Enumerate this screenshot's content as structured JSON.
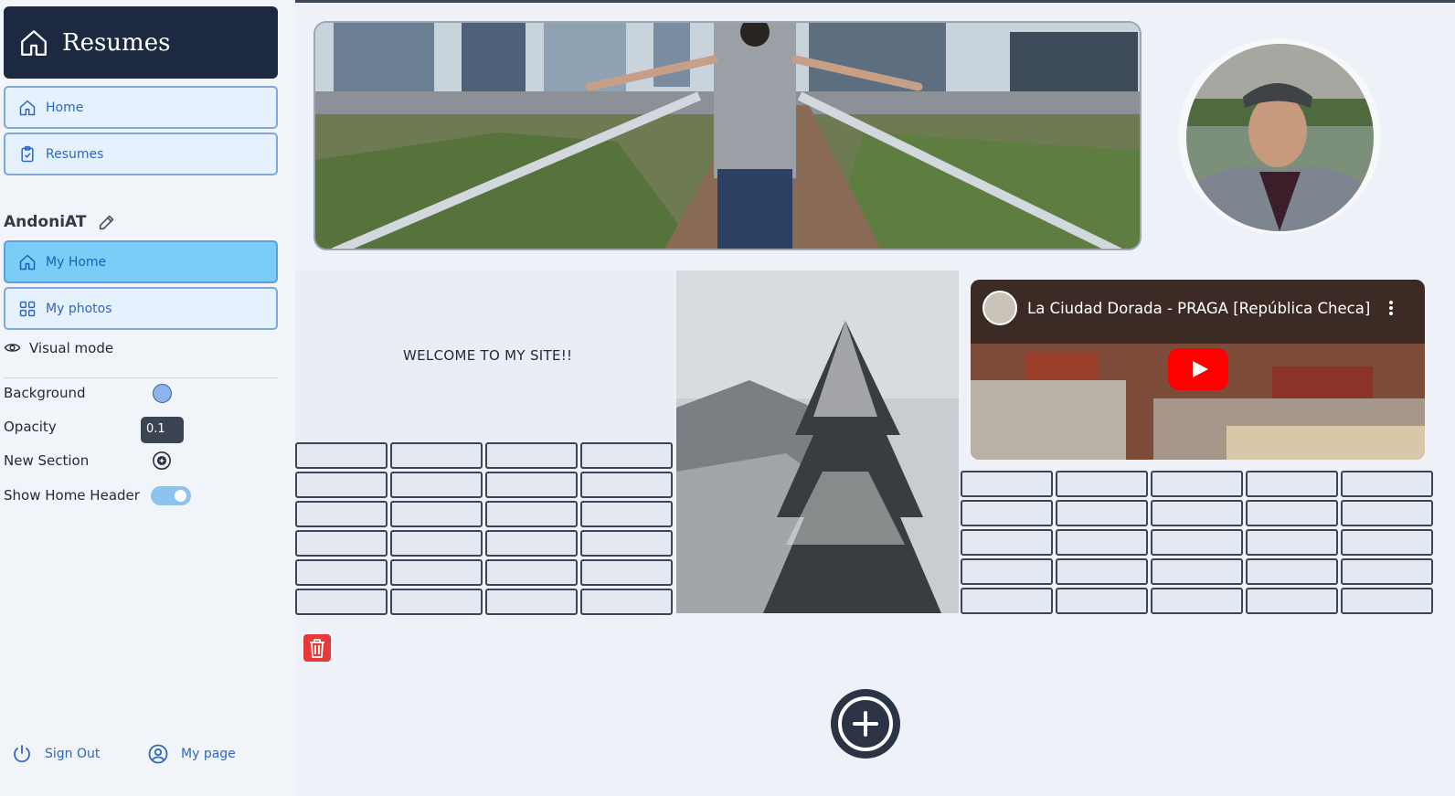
{
  "sidebar": {
    "brand": "Resumes",
    "nav": [
      {
        "label": "Home",
        "icon": "home-icon"
      },
      {
        "label": "Resumes",
        "icon": "clipboard-check-icon"
      }
    ],
    "username": "AndoniAT",
    "user_nav": [
      {
        "label": "My Home",
        "icon": "home-icon",
        "active": true
      },
      {
        "label": "My photos",
        "icon": "grid-icon",
        "active": false
      }
    ],
    "visual_mode_label": "Visual mode",
    "settings": {
      "background_label": "Background",
      "background_color": "#8db3ec",
      "opacity_label": "Opacity",
      "opacity_value": "0.1",
      "new_section_label": "New Section",
      "show_header_label": "Show Home Header",
      "show_header_on": true
    },
    "footer": {
      "sign_out": "Sign Out",
      "my_page": "My page"
    }
  },
  "main": {
    "welcome_text": "WELCOME TO MY SITE!!",
    "video": {
      "title": "La Ciudad Dorada - PRAGA [República Checa]"
    }
  },
  "colors": {
    "sidebar_bg": "#f1f4f9",
    "brand_bg": "#1c2940",
    "nav_border": "#7fa7d8",
    "nav_active": "#79cdf7",
    "accent": "#2f66c2",
    "delete": "#e63a3a"
  }
}
